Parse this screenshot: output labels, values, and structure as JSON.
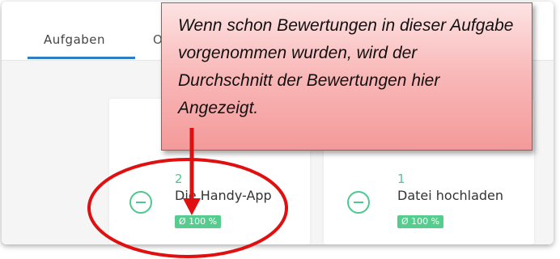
{
  "tabs": [
    {
      "label": "Aufgaben",
      "active": true
    },
    {
      "label": "O"
    }
  ],
  "cards": [
    {
      "count": "2",
      "title": "Die Handy-App",
      "rating": "Ø 100 %"
    },
    {
      "count": "1",
      "title": "Datei hochladen",
      "rating": "Ø 100 %"
    }
  ],
  "callout": {
    "text": "Wenn schon Bewertungen in dieser Aufgabe vorgenommen wurden, wird der Durchschnitt der Bewertungen hier Angezeigt."
  },
  "colors": {
    "accent_green": "#4cc98f",
    "badge_green": "#56cc8f",
    "tab_underline": "#2f7ec2",
    "annotation_red": "#e01010",
    "callout_border": "#c44a4a"
  },
  "icons": [
    "minus-circle-icon",
    "annotation-arrow-icon",
    "highlight-ellipse-icon"
  ]
}
